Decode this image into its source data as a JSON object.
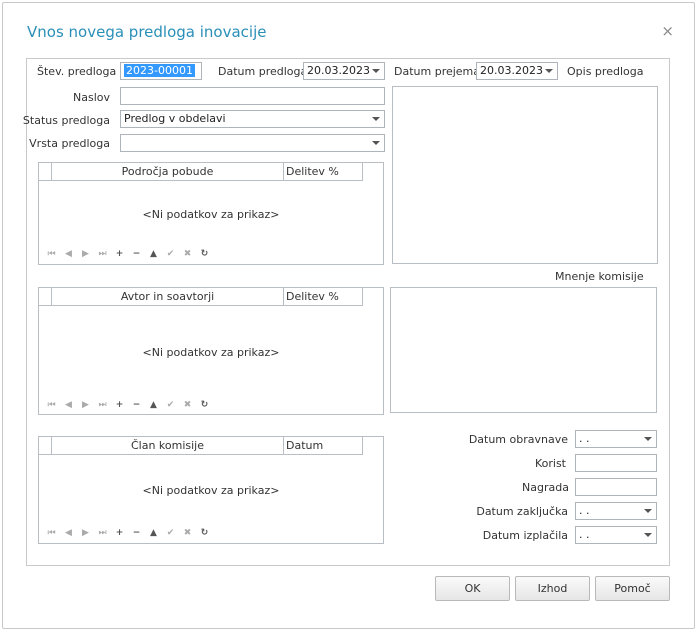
{
  "dialog": {
    "title": "Vnos novega predloga inovacije",
    "close_glyph": "×"
  },
  "form": {
    "stev_label": "Štev. predloga",
    "stev_value": "2023-00001",
    "datum_predloga_label": "Datum predloga",
    "datum_predloga_value": "20.03.2023",
    "datum_prejema_label": "Datum prejema",
    "datum_prejema_value": "20.03.2023",
    "opis_label": "Opis predloga",
    "naslov_label": "Naslov",
    "naslov_value": "",
    "status_label": "Status predloga",
    "status_value": "Predlog v obdelavi",
    "vrsta_label": "Vrsta predloga",
    "vrsta_value": "",
    "mnenje_label": "Mnenje komisije",
    "datum_obravnave_label": "Datum obravnave",
    "datum_obravnave_value": " .  .",
    "korist_label": "Korist",
    "korist_value": "",
    "nagrada_label": "Nagrada",
    "nagrada_value": "",
    "datum_zakljucka_label": "Datum zaključka",
    "datum_zakljucka_value": " .  .",
    "datum_izplacila_label": "Datum izplačila",
    "datum_izplacila_value": " .  ."
  },
  "grids": {
    "podrocja": {
      "col1": "Področja pobude",
      "col2": "Delitev %",
      "empty": "<Ni podatkov za prikaz>"
    },
    "avtor": {
      "col1": "Avtor in soavtorji",
      "col2": "Delitev %",
      "empty": "<Ni podatkov za prikaz>"
    },
    "clan": {
      "col1": "Član komisije",
      "col2": "Datum",
      "empty": "<Ni podatkov za prikaz>"
    }
  },
  "navigator": {
    "first": "first-page-icon",
    "prev_page": "prev-page-icon",
    "next_page": "next-page-icon",
    "last": "last-page-icon",
    "add": "plus-icon",
    "remove": "minus-icon",
    "edit": "up-triangle-icon",
    "confirm": "check-icon",
    "cancel": "x-icon",
    "refresh": "refresh-icon"
  },
  "buttons": {
    "ok": "OK",
    "izhod": "Izhod",
    "pomoc": "Pomoč"
  },
  "colors": {
    "title": "#2a8fb8",
    "selection": "#3399ff",
    "border": "#b8bec4"
  }
}
